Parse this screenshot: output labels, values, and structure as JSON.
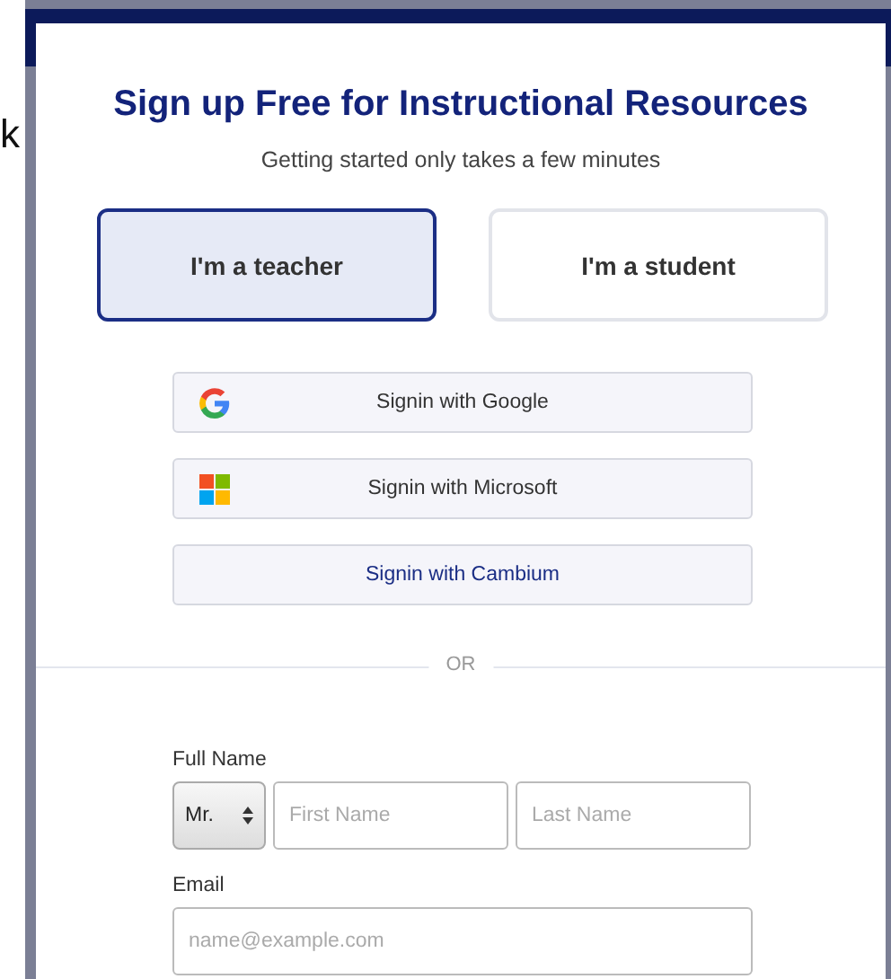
{
  "background": {
    "fragment": "k"
  },
  "modal": {
    "title": "Sign up Free for Instructional Resources",
    "subtitle": "Getting started only takes a few minutes",
    "roles": [
      {
        "label": "I'm a teacher",
        "selected": true
      },
      {
        "label": "I'm a student",
        "selected": false
      }
    ],
    "providers": [
      {
        "kind": "google",
        "label": "Signin with Google"
      },
      {
        "kind": "microsoft",
        "label": "Signin with Microsoft"
      },
      {
        "kind": "cambium",
        "label": "Signin with Cambium"
      }
    ],
    "divider": "OR",
    "full_name": {
      "label": "Full Name",
      "title": "Mr.",
      "first_placeholder": "First Name",
      "last_placeholder": "Last Name"
    },
    "email": {
      "label": "Email",
      "placeholder": "name@example.com"
    }
  }
}
